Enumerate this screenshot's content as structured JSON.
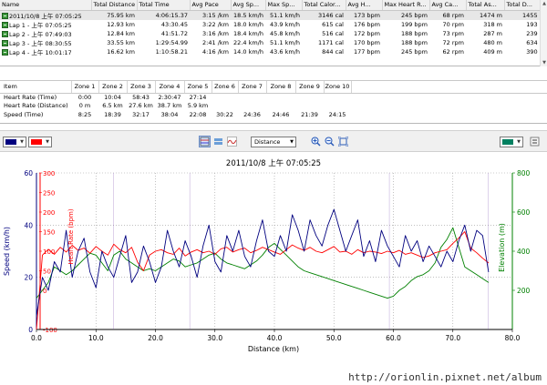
{
  "laps": {
    "columns": [
      "Name",
      "Total Distance",
      "Total Time",
      "Avg Pace",
      "Avg Sp...",
      "Max Sp...",
      "Total Calor...",
      "Avg H...",
      "Max Heart R...",
      "Avg Ca...",
      "Total As...",
      "Total D..."
    ],
    "rows": [
      [
        "2011/10/8 上午 07:05:25",
        "75.95 km",
        "4:06:15.37",
        "3:15 /km",
        "18.5 km/h",
        "51.1 km/h",
        "3146 cal",
        "173 bpm",
        "245 bpm",
        "68 rpm",
        "1474 m",
        "1455 m"
      ],
      [
        "Lap 1 - 上午 07:05:25",
        "12.93 km",
        "43:30.45",
        "3:22 /km",
        "18.0 km/h",
        "43.9 km/h",
        "615 cal",
        "176 bpm",
        "199 bpm",
        "70 rpm",
        "318 m",
        "193 m"
      ],
      [
        "Lap 2 - 上午 07:49:03",
        "12.84 km",
        "41:51.72",
        "3:16 /km",
        "18.4 km/h",
        "45.8 km/h",
        "516 cal",
        "172 bpm",
        "188 bpm",
        "73 rpm",
        "287 m",
        "239 m"
      ],
      [
        "Lap 3 - 上午 08:30:55",
        "33.55 km",
        "1:29:54.99",
        "2:41 /km",
        "22.4 km/h",
        "51.1 km/h",
        "1171 cal",
        "170 bpm",
        "188 bpm",
        "72 rpm",
        "480 m",
        "634 m"
      ],
      [
        "Lap 4 - 上午 10:01:17",
        "16.62 km",
        "1:10:58.21",
        "4:16 /km",
        "14.0 km/h",
        "43.6 km/h",
        "844 cal",
        "177 bpm",
        "245 bpm",
        "62 rpm",
        "409 m",
        "390 m"
      ]
    ]
  },
  "zones": {
    "columns": [
      "Item",
      "Zone 1",
      "Zone 2",
      "Zone 3",
      "Zone 4",
      "Zone 5",
      "Zone 6",
      "Zone 7",
      "Zone 8",
      "Zone 9",
      "Zone 10"
    ],
    "rows": [
      [
        "Heart Rate (Time)",
        "0:00",
        "10:04",
        "58:43",
        "2:30:47",
        "27:14",
        "",
        "",
        "",
        "",
        ""
      ],
      [
        "Heart Rate (Distance)",
        "0 m",
        "6.5 km",
        "27.6 km",
        "38.7 km",
        "5.9 km",
        "",
        "",
        "",
        "",
        ""
      ],
      [
        "Speed (Time)",
        "8:25",
        "18:39",
        "32:17",
        "38:04",
        "22:08",
        "30:22",
        "24:36",
        "24:46",
        "21:39",
        "24:15"
      ]
    ]
  },
  "toolbar": {
    "color_left_1": "#00007f",
    "color_left_2": "#ff0000",
    "axis_selector": "Distance",
    "color_right": "#008060",
    "icons": [
      "chart-stacked-icon",
      "chart-bars-icon",
      "chart-wave-icon",
      "zoom-in-icon",
      "zoom-out-icon",
      "fit-icon"
    ]
  },
  "chart_data": {
    "type": "line",
    "title": "2011/10/8 上午 07:05:25",
    "xlabel": "Distance (km)",
    "ylabel_left": "Speed (km/h)",
    "ylabel_heart": "Heart Rate (bpm)",
    "ylabel_right": "Elevation (m)",
    "xlim": [
      0,
      80
    ],
    "speed_lim": [
      0,
      60
    ],
    "heart_lim": [
      -100,
      300
    ],
    "elev_lim": [
      0,
      800
    ],
    "x_ticks": [
      "0.0",
      "10.0",
      "20.0",
      "30.0",
      "40.0",
      "50.0",
      "60.0",
      "70.0",
      "80.0"
    ],
    "speed_ticks": [
      "0",
      "20",
      "40",
      "60"
    ],
    "heart_ticks": [
      "-100",
      "0",
      "50",
      "100",
      "150",
      "200",
      "250",
      "300"
    ],
    "elev_ticks": [
      "200",
      "400",
      "600",
      "800"
    ],
    "lap_markers_km": [
      0,
      12.93,
      25.77,
      59.32,
      75.95
    ],
    "colors": {
      "speed": "#00007f",
      "heart": "#ff0000",
      "elevation": "#008000"
    },
    "series": [
      {
        "name": "Speed (km/h)",
        "x": [
          0,
          1,
          2,
          3,
          4,
          5,
          6,
          7,
          8,
          9,
          10,
          11,
          12,
          13,
          14,
          15,
          16,
          17,
          18,
          19,
          20,
          21,
          22,
          23,
          24,
          25,
          26,
          27,
          28,
          29,
          30,
          31,
          32,
          33,
          34,
          35,
          36,
          37,
          38,
          39,
          40,
          41,
          42,
          43,
          44,
          45,
          46,
          47,
          48,
          49,
          50,
          51,
          52,
          53,
          54,
          55,
          56,
          57,
          58,
          59,
          60,
          61,
          62,
          63,
          64,
          65,
          66,
          67,
          68,
          69,
          70,
          71,
          72,
          73,
          74,
          75,
          76
        ],
        "values": [
          5,
          20,
          15,
          26,
          22,
          38,
          20,
          30,
          35,
          22,
          16,
          30,
          24,
          20,
          28,
          36,
          18,
          22,
          32,
          26,
          18,
          24,
          38,
          30,
          24,
          34,
          28,
          20,
          32,
          40,
          26,
          22,
          36,
          30,
          38,
          28,
          24,
          34,
          42,
          30,
          28,
          36,
          30,
          44,
          38,
          30,
          42,
          36,
          32,
          40,
          46,
          38,
          30,
          36,
          42,
          28,
          34,
          26,
          38,
          32,
          28,
          24,
          36,
          30,
          34,
          26,
          32,
          28,
          24,
          30,
          26,
          34,
          40,
          30,
          38,
          36,
          22
        ]
      },
      {
        "name": "Heart Rate (bpm)",
        "x": [
          0,
          1,
          2,
          3,
          4,
          5,
          6,
          7,
          8,
          9,
          10,
          11,
          12,
          13,
          14,
          15,
          16,
          17,
          18,
          19,
          20,
          21,
          22,
          23,
          24,
          25,
          26,
          27,
          28,
          29,
          30,
          31,
          32,
          33,
          34,
          35,
          36,
          37,
          38,
          39,
          40,
          41,
          42,
          43,
          44,
          45,
          46,
          47,
          48,
          49,
          50,
          51,
          52,
          53,
          54,
          55,
          56,
          57,
          58,
          59,
          60,
          61,
          62,
          63,
          64,
          65,
          66,
          67,
          68,
          69,
          70,
          71,
          72,
          73,
          74,
          75,
          76
        ],
        "values": [
          -100,
          90,
          105,
          92,
          110,
          98,
          115,
          102,
          108,
          95,
          112,
          100,
          90,
          118,
          104,
          96,
          110,
          72,
          50,
          90,
          100,
          104,
          96,
          92,
          108,
          88,
          98,
          104,
          96,
          100,
          92,
          106,
          110,
          98,
          104,
          108,
          96,
          102,
          110,
          104,
          98,
          92,
          104,
          116,
          108,
          102,
          110,
          100,
          96,
          104,
          112,
          98,
          100,
          92,
          104,
          96,
          100,
          98,
          94,
          100,
          96,
          102,
          92,
          96,
          90,
          84,
          88,
          96,
          100,
          104,
          120,
          134,
          150,
          108,
          96,
          82,
          70
        ]
      },
      {
        "name": "Elevation (m)",
        "x": [
          0,
          1,
          2,
          3,
          4,
          5,
          6,
          7,
          8,
          9,
          10,
          11,
          12,
          13,
          14,
          15,
          16,
          17,
          18,
          19,
          20,
          21,
          22,
          23,
          24,
          25,
          26,
          27,
          28,
          29,
          30,
          31,
          32,
          33,
          34,
          35,
          36,
          37,
          38,
          39,
          40,
          41,
          42,
          43,
          44,
          45,
          46,
          47,
          48,
          49,
          50,
          51,
          52,
          53,
          54,
          55,
          56,
          57,
          58,
          59,
          60,
          61,
          62,
          63,
          64,
          65,
          66,
          67,
          68,
          69,
          70,
          71,
          72,
          73,
          74,
          75,
          76
        ],
        "values": [
          160,
          200,
          240,
          320,
          300,
          280,
          300,
          330,
          360,
          390,
          380,
          340,
          300,
          380,
          400,
          360,
          340,
          320,
          300,
          310,
          300,
          320,
          340,
          360,
          350,
          320,
          330,
          340,
          360,
          380,
          390,
          360,
          340,
          330,
          320,
          310,
          330,
          350,
          380,
          420,
          440,
          410,
          380,
          350,
          320,
          300,
          290,
          280,
          270,
          260,
          250,
          240,
          230,
          220,
          210,
          200,
          190,
          180,
          170,
          160,
          170,
          200,
          220,
          250,
          270,
          280,
          300,
          340,
          420,
          460,
          520,
          420,
          320,
          300,
          280,
          260,
          240
        ]
      }
    ],
    "watermark": "http://orionlin.pixnet.net/album"
  }
}
